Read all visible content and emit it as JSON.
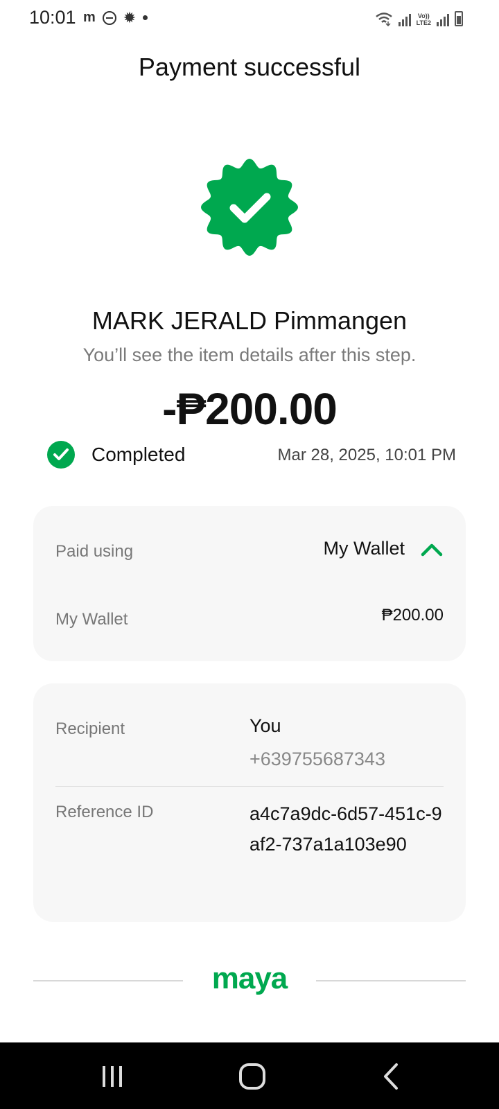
{
  "status_bar": {
    "time": "10:01",
    "left_icons": [
      "m",
      "do-not-disturb-icon",
      "settings-icon",
      "notification-dot"
    ],
    "right_icons": [
      "wifi-icon",
      "signal-icon",
      "volte-lte2-icon",
      "signal-icon",
      "battery-icon"
    ],
    "network_label_top": "Vo))",
    "network_label_bottom": "LTE2"
  },
  "header": {
    "title": "Payment successful"
  },
  "badge": {
    "icon": "verified-check-badge-icon",
    "color": "#00a84f"
  },
  "transaction": {
    "recipient_name": "MARK JERALD Pimmangen",
    "subtitle": "You’ll see the item details after this step.",
    "amount": "-₱200.00",
    "status": "Completed",
    "date": "Mar 28, 2025, 10:01 PM"
  },
  "payment_card": {
    "paid_using_label": "Paid using",
    "paid_using_value": "My Wallet",
    "wallet_label": "My Wallet",
    "wallet_amount": "₱200.00"
  },
  "details_card": {
    "recipient_label": "Recipient",
    "recipient_value": "You",
    "recipient_phone": "+639755687343",
    "reference_label": "Reference ID",
    "reference_value": "a4c7a9dc-6d57-451c-9af2-737a1a103e90"
  },
  "footer": {
    "brand": "maya"
  },
  "nav": {
    "buttons": [
      "recent-apps-icon",
      "home-icon",
      "back-icon"
    ]
  },
  "colors": {
    "accent": "#00a84f",
    "card_bg": "#f7f7f7",
    "nav_bg": "#000000"
  }
}
